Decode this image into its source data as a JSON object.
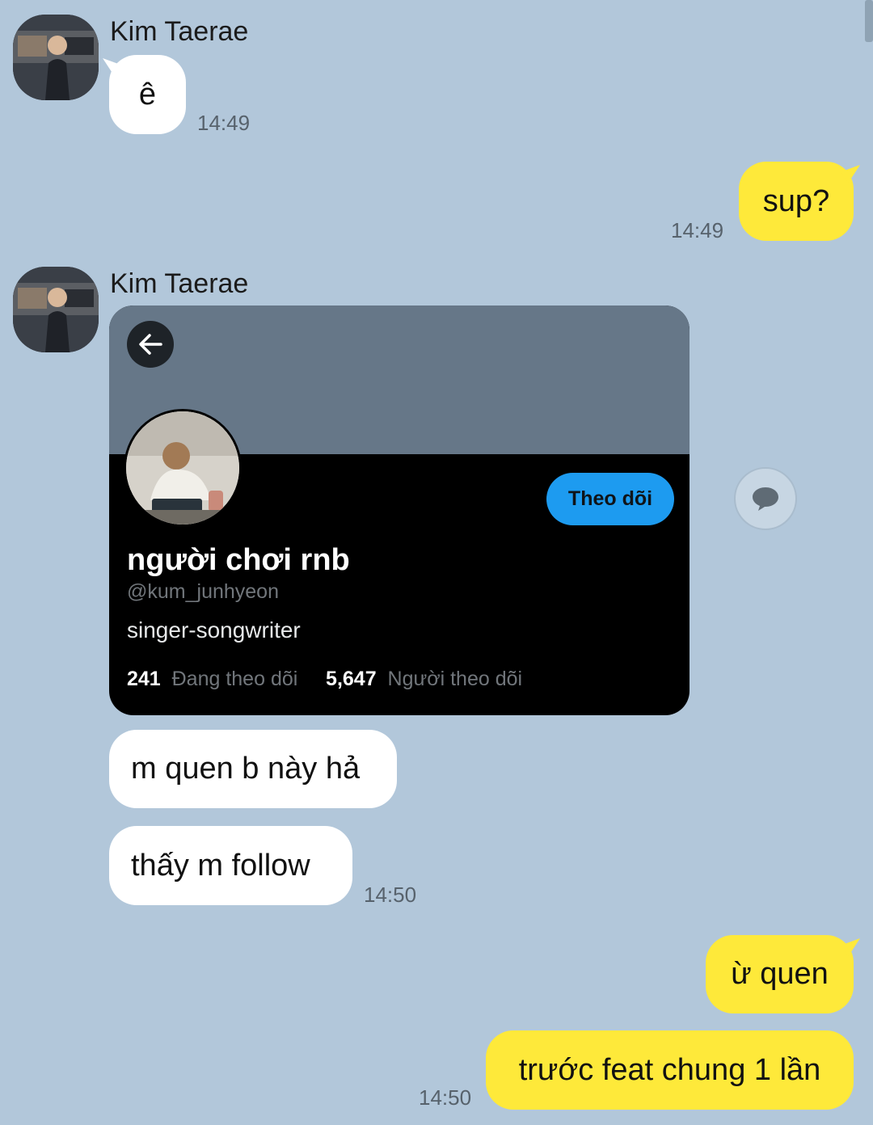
{
  "messages": {
    "m1": {
      "sender": "Kim Taerae",
      "text": "ê",
      "time": "14:49"
    },
    "m2": {
      "text": "sup?",
      "time": "14:49"
    },
    "m3": {
      "sender": "Kim Taerae"
    },
    "m4": {
      "text": "m quen b này hả"
    },
    "m5": {
      "text": "thấy m follow",
      "time": "14:50"
    },
    "m6": {
      "text": "ừ quen"
    },
    "m7": {
      "text": "trước feat chung 1 lần",
      "time": "14:50"
    }
  },
  "profile_card": {
    "display_name": "người chơi rnb",
    "handle": "@kum_junhyeon",
    "bio": "singer-songwriter",
    "follow_label": "Theo dõi",
    "following_count": "241",
    "following_label": "Đang theo dõi",
    "followers_count": "5,647",
    "followers_label": "Người theo dõi"
  },
  "colors": {
    "background": "#b2c7da",
    "outgoing_bubble": "#fee93a",
    "incoming_bubble": "#ffffff",
    "follow_button": "#1d9bf0",
    "card_banner": "#667788"
  },
  "icons": [
    "back-arrow-icon",
    "share-bubble-icon"
  ]
}
